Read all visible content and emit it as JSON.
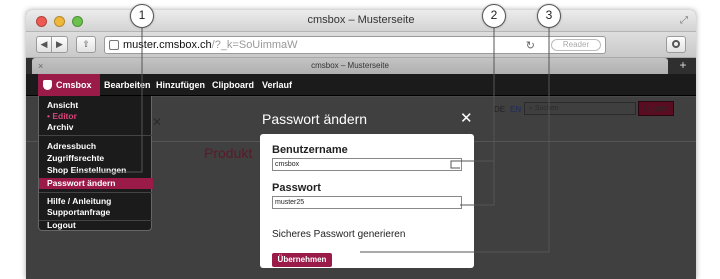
{
  "window": {
    "title": "cmsbox – Musterseite"
  },
  "toolbar": {
    "url_host": "muster.cmsbox.ch",
    "url_rest": "/?_k=SoUimmaW",
    "reader_label": "Reader"
  },
  "tab": {
    "title": "cmsbox – Musterseite"
  },
  "cms_menu": {
    "brand": "Cmsbox",
    "items": [
      "Bearbeiten",
      "Hinzufügen",
      "Clipboard",
      "Verlauf"
    ]
  },
  "dropdown": {
    "items": [
      "Ansicht",
      "• Editor",
      "Archiv",
      "Adressbuch",
      "Zugriffsrechte",
      "Shop Einstellungen",
      "Passwort ändern",
      "Hilfe / Anleitung",
      "Supportanfrage",
      "Logout"
    ]
  },
  "page": {
    "lang_de": "DE",
    "lang_en": "EN",
    "search_placeholder": "Suchen",
    "logout": "Logout",
    "heading": "Produkt"
  },
  "modal": {
    "title": "Passwort ändern",
    "username_label": "Benutzername",
    "username_value": "cmsbox",
    "password_label": "Passwort",
    "password_value": "muster25",
    "generate_link": "Sicheres Passwort generieren",
    "submit": "Übernehmen"
  },
  "callouts": [
    "1",
    "2",
    "3"
  ]
}
